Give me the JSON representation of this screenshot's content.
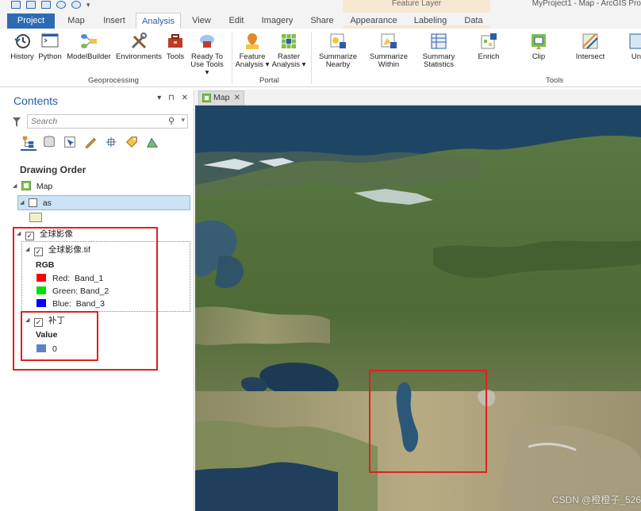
{
  "titlebar": {
    "context_group": "Feature Layer",
    "app_title": "MyProject1 - Map - ArcGIS Pro",
    "qat_dropdown": "▾"
  },
  "tabs": [
    {
      "label": "Project"
    },
    {
      "label": "Map"
    },
    {
      "label": "Insert"
    },
    {
      "label": "Analysis"
    },
    {
      "label": "View"
    },
    {
      "label": "Edit"
    },
    {
      "label": "Imagery"
    },
    {
      "label": "Share"
    },
    {
      "label": "Appearance"
    },
    {
      "label": "Labeling"
    },
    {
      "label": "Data"
    }
  ],
  "ribbon": {
    "geoprocessing": {
      "label": "Geoprocessing",
      "buttons": [
        {
          "label": "History",
          "icon": "history-icon"
        },
        {
          "label": "Python",
          "icon": "python-icon"
        },
        {
          "label": "ModelBuilder",
          "icon": "modelbuilder-icon"
        },
        {
          "label": "Environments",
          "icon": "environments-icon"
        },
        {
          "label": "Tools",
          "icon": "toolbox-icon"
        },
        {
          "label": "Ready To",
          "label2": "Use Tools ▾",
          "icon": "ready-to-use-icon"
        }
      ]
    },
    "portal": {
      "label": "Portal",
      "buttons": [
        {
          "label": "Feature",
          "label2": "Analysis ▾",
          "icon": "feature-analysis-icon"
        },
        {
          "label": "Raster",
          "label2": "Analysis ▾",
          "icon": "raster-analysis-icon"
        }
      ]
    },
    "tools": {
      "label": "Tools",
      "buttons": [
        {
          "label": "Summarize",
          "label2": "Nearby",
          "icon": "summarize-nearby-icon"
        },
        {
          "label": "Summarize",
          "label2": "Within",
          "icon": "summarize-within-icon"
        },
        {
          "label": "Summary",
          "label2": "Statistics",
          "icon": "summary-statistics-icon"
        },
        {
          "label": "Enrich",
          "icon": "enrich-icon"
        },
        {
          "label": "Clip",
          "icon": "clip-icon"
        },
        {
          "label": "Intersect",
          "icon": "intersect-icon"
        },
        {
          "label": "Uni",
          "icon": "union-icon"
        }
      ]
    }
  },
  "contents": {
    "title": "Contents",
    "controls": "▾ ⊓ ✕",
    "search_placeholder": "Search",
    "drawing_order": "Drawing Order",
    "map_name": "Map",
    "layers": {
      "as": {
        "name": "as",
        "checked": false
      },
      "global": {
        "name": "全球影像",
        "checked": true
      },
      "global_tif": {
        "name": "全球影像.tif",
        "checked": true,
        "heading": "RGB",
        "bands": [
          {
            "channel": "Red:",
            "band": "Band_1",
            "color": "#ff0000"
          },
          {
            "channel": "Green:",
            "band": "Band_2",
            "color": "#00e000"
          },
          {
            "channel": "Blue:",
            "band": "Band_3",
            "color": "#0000ff"
          }
        ]
      },
      "patch": {
        "name": "补丁",
        "checked": true,
        "heading": "Value",
        "entries": [
          {
            "value": "0",
            "color": "#5b84c4"
          }
        ]
      }
    }
  },
  "map_tab": {
    "label": "Map"
  },
  "watermark": "CSDN @橙橙子_526",
  "colors": {
    "accent": "#2a5ca8",
    "project_tab": "#2d6bb5",
    "highlight_box": "#e02020",
    "selection": "#cce2f5"
  }
}
